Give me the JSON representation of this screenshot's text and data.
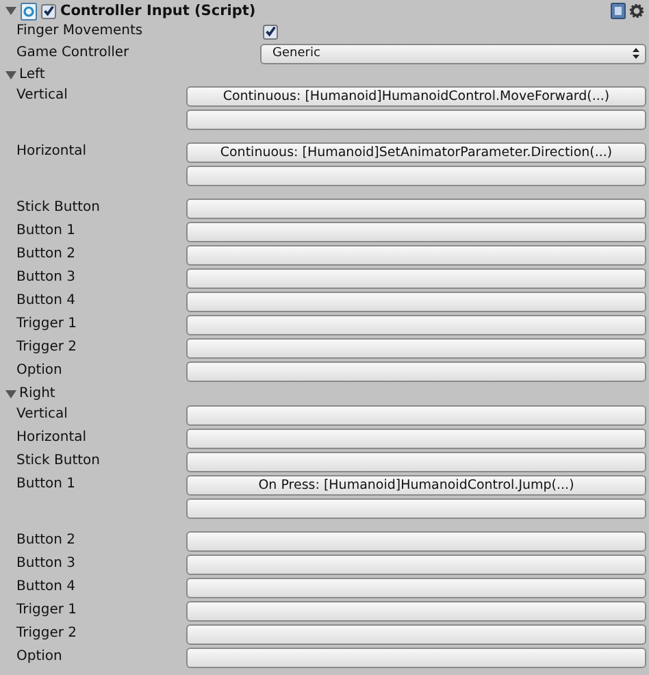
{
  "component": {
    "title": "Controller Input (Script)",
    "expanded": true,
    "enabled": true
  },
  "fields": [
    {
      "kind": "checkbox",
      "label": "Finger Movements",
      "checked": true
    },
    {
      "kind": "dropdown",
      "label": "Game Controller",
      "value": "Generic"
    }
  ],
  "sections": [
    {
      "title": "Left",
      "expanded": true,
      "rows": [
        {
          "label": "Vertical",
          "slots": [
            {
              "kind": "event",
              "label": "Continuous: [Humanoid]HumanoidControl.MoveForward(...)"
            },
            {
              "kind": "empty"
            }
          ]
        },
        {
          "label": "Horizontal",
          "slots": [
            {
              "kind": "event",
              "label": "Continuous: [Humanoid]SetAnimatorParameter.Direction(...)"
            },
            {
              "kind": "empty"
            }
          ]
        },
        {
          "label": "Stick Button",
          "slots": [
            {
              "kind": "empty"
            }
          ]
        },
        {
          "label": "Button 1",
          "slots": [
            {
              "kind": "empty"
            }
          ]
        },
        {
          "label": "Button 2",
          "slots": [
            {
              "kind": "empty"
            }
          ]
        },
        {
          "label": "Button 3",
          "slots": [
            {
              "kind": "empty"
            }
          ]
        },
        {
          "label": "Button 4",
          "slots": [
            {
              "kind": "empty"
            }
          ]
        },
        {
          "label": "Trigger 1",
          "slots": [
            {
              "kind": "empty"
            }
          ]
        },
        {
          "label": "Trigger 2",
          "slots": [
            {
              "kind": "empty"
            }
          ]
        },
        {
          "label": "Option",
          "slots": [
            {
              "kind": "empty"
            }
          ]
        }
      ]
    },
    {
      "title": "Right",
      "expanded": true,
      "rows": [
        {
          "label": "Vertical",
          "slots": [
            {
              "kind": "empty"
            }
          ]
        },
        {
          "label": "Horizontal",
          "slots": [
            {
              "kind": "empty"
            }
          ]
        },
        {
          "label": "Stick Button",
          "slots": [
            {
              "kind": "empty"
            }
          ]
        },
        {
          "label": "Button 1",
          "slots": [
            {
              "kind": "event",
              "label": "On Press: [Humanoid]HumanoidControl.Jump(...)"
            },
            {
              "kind": "empty"
            }
          ]
        },
        {
          "label": "Button 2",
          "slots": [
            {
              "kind": "empty"
            }
          ]
        },
        {
          "label": "Button 3",
          "slots": [
            {
              "kind": "empty"
            }
          ]
        },
        {
          "label": "Button 4",
          "slots": [
            {
              "kind": "empty"
            }
          ]
        },
        {
          "label": "Trigger 1",
          "slots": [
            {
              "kind": "empty"
            }
          ]
        },
        {
          "label": "Trigger 2",
          "slots": [
            {
              "kind": "empty"
            }
          ]
        },
        {
          "label": "Option",
          "slots": [
            {
              "kind": "empty"
            }
          ]
        }
      ]
    }
  ]
}
